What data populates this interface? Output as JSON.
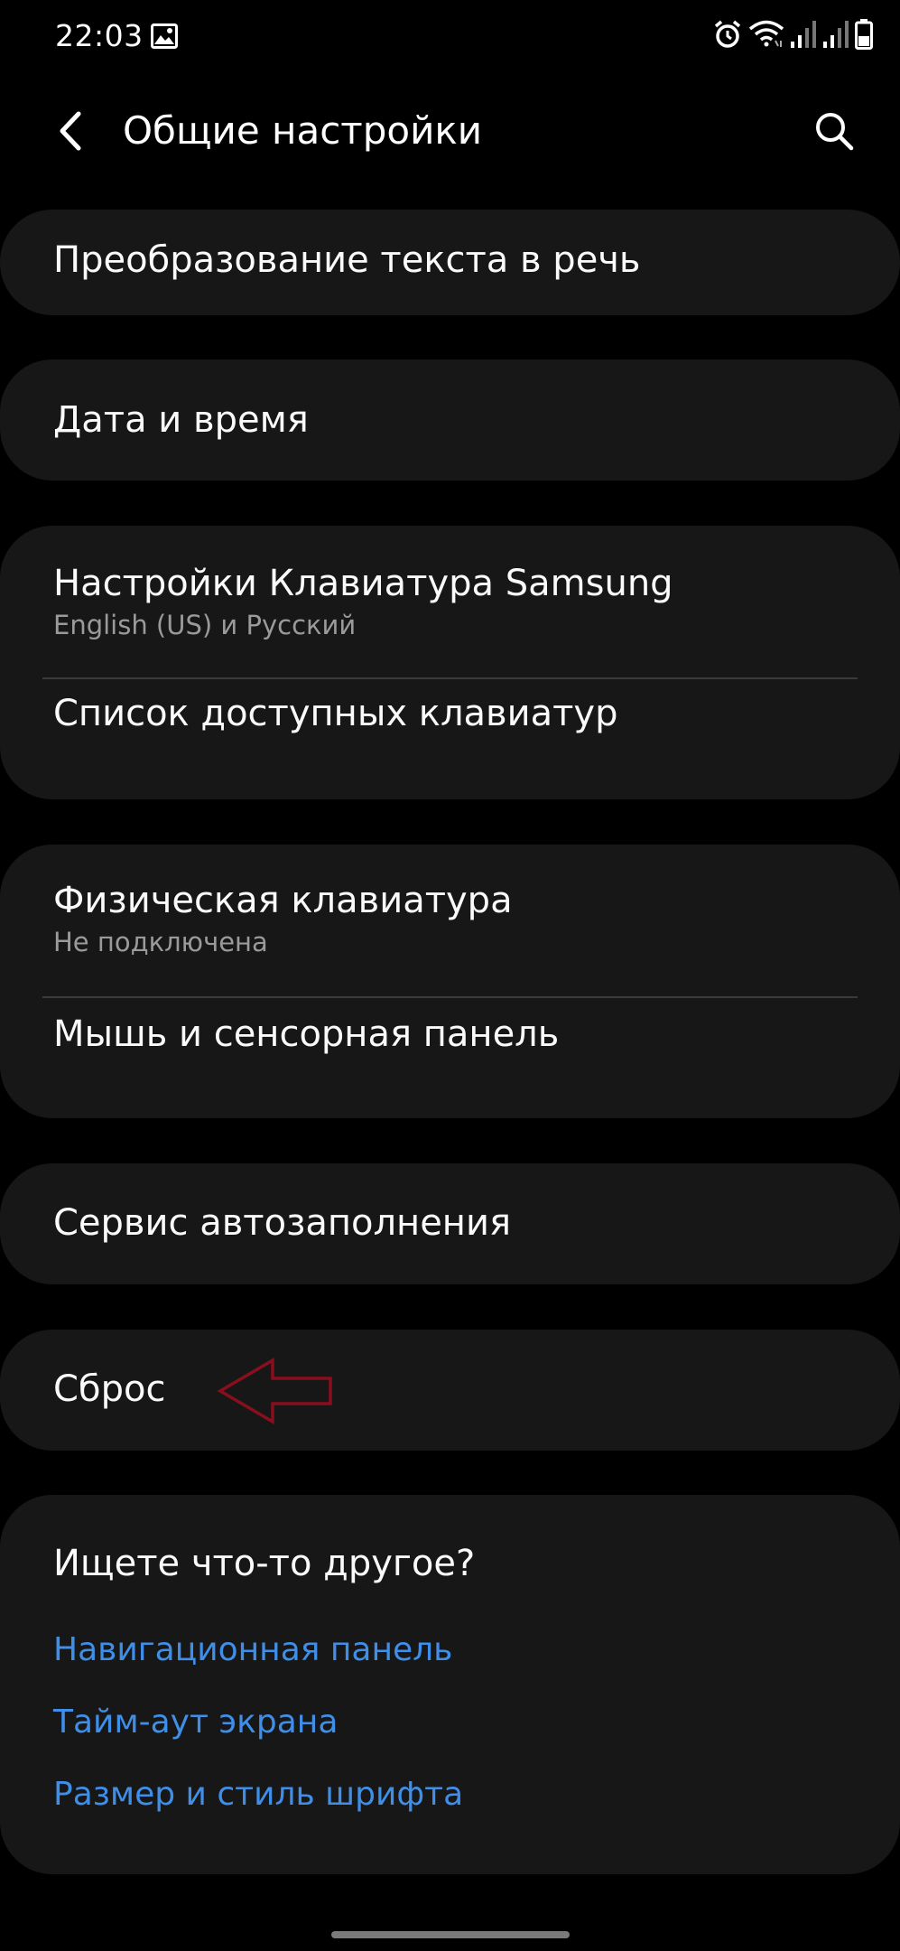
{
  "status_bar": {
    "time": "22:03",
    "icons": [
      "gallery-icon",
      "alarm-icon",
      "wifi-icon",
      "signal-icon",
      "signal-icon",
      "battery-icon"
    ]
  },
  "header": {
    "title": "Общие настройки",
    "back_icon": "back-arrow-icon",
    "search_icon": "search-icon"
  },
  "items": {
    "tts": {
      "title": "Преобразование текста в речь"
    },
    "datetime": {
      "title": "Дата и время"
    },
    "samsung_keyboard": {
      "title": "Настройки Клавиатура Samsung",
      "subtitle": "English (US) и Русский"
    },
    "keyboard_list": {
      "title": "Список доступных клавиатур"
    },
    "physical_keyboard": {
      "title": "Физическая клавиатура",
      "subtitle": "Не подключена"
    },
    "mouse_touchpad": {
      "title": "Мышь и сенсорная панель"
    },
    "autofill": {
      "title": "Сервис автозаполнения"
    },
    "reset": {
      "title": "Сброс"
    }
  },
  "suggestions": {
    "heading": "Ищете что-то другое?",
    "links": [
      "Навигационная панель",
      "Тайм-аут экрана",
      "Размер и стиль шрифта"
    ]
  },
  "annotation": {
    "icon": "red-arrow-left-icon",
    "color": "#8a0f1e"
  },
  "colors": {
    "background": "#000000",
    "card": "#171717",
    "link": "#3f8ee8",
    "subtitle": "#9a9a9a"
  }
}
